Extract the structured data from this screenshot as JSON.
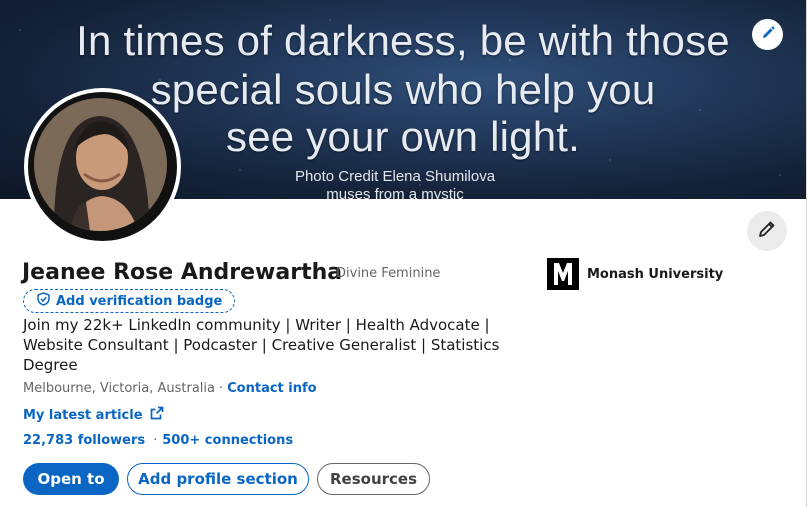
{
  "banner": {
    "quote_lines": [
      "In times of darkness, be with those",
      "special souls who help you",
      "see your own light."
    ],
    "credit_lines": [
      "Photo Credit Elena Shumilova",
      "muses from a mystic"
    ],
    "edit_icon": "pencil-icon"
  },
  "profile": {
    "name": "Jeanee Rose Andrewartha",
    "pronouns": "Divine Feminine",
    "verification_label": "Add verification badge",
    "headline": "Join my 22k+ LinkedIn community | Writer | Health Advocate | Website Consultant | Podcaster | Creative Generalist | Statistics Degree",
    "location": "Melbourne, Victoria, Australia",
    "location_separator": "·",
    "contact_label": "Contact info",
    "article_label": "My latest article",
    "followers": "22,783 followers",
    "network_separator": "·",
    "connections": "500+ connections"
  },
  "actions": {
    "open_to": "Open to",
    "add_section": "Add profile section",
    "resources": "Resources"
  },
  "education": {
    "name": "Monash University",
    "logo_icon": "monash-logo"
  },
  "colors": {
    "accent": "#0a66c2",
    "muted_text": "#666666",
    "edit_bg": "#ebebeb"
  }
}
